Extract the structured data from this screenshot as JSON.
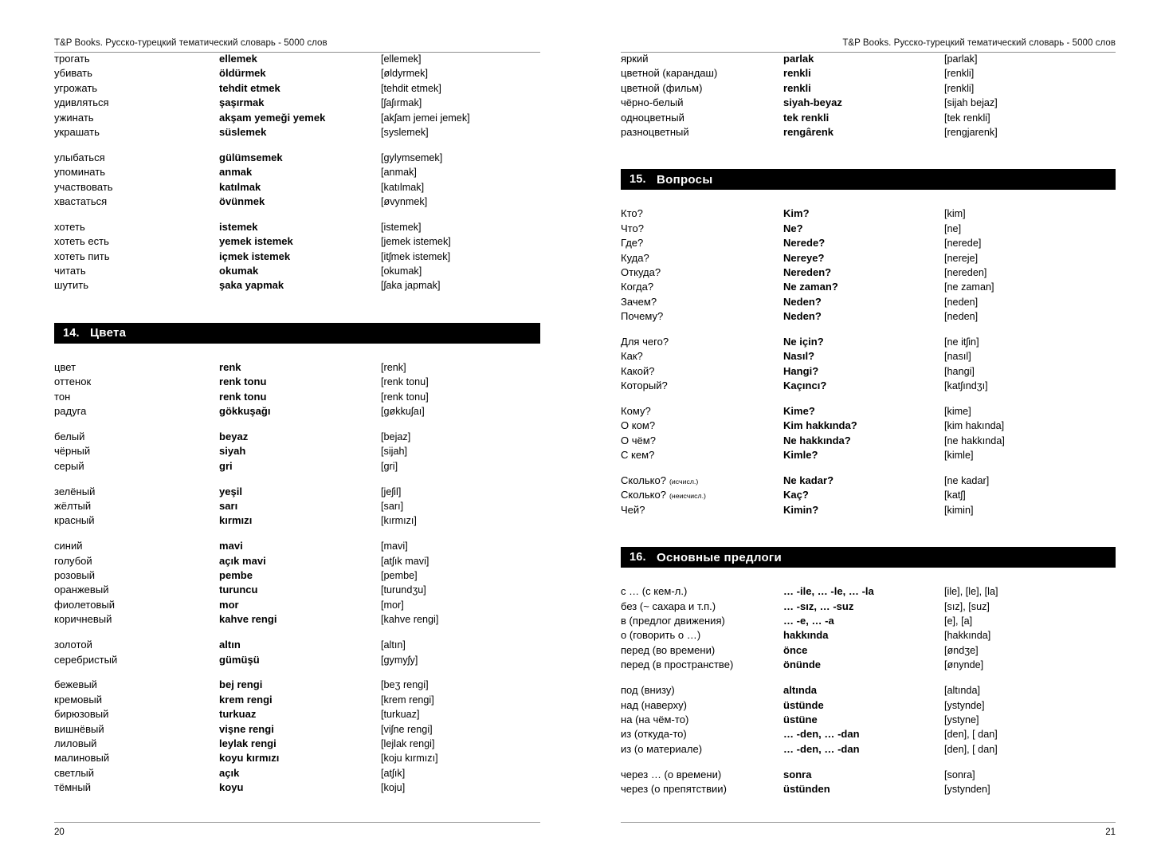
{
  "book": {
    "running_header": "T&P Books. Русско-турецкий тематический словарь - 5000 слов"
  },
  "left_page": {
    "page_number": "20",
    "blocks": [
      {
        "kind": "entries",
        "rows": [
          {
            "ru": "трогать",
            "tr": "ellemek",
            "ph": "[ellemek]"
          },
          {
            "ru": "убивать",
            "tr": "öldürmek",
            "ph": "[øldyrmek]"
          },
          {
            "ru": "угрожать",
            "tr": "tehdit etmek",
            "ph": "[tehdit etmek]"
          },
          {
            "ru": "удивляться",
            "tr": "şaşırmak",
            "ph": "[ʃaʃırmak]"
          },
          {
            "ru": "ужинать",
            "tr": "akşam yemeği yemek",
            "ph": "[akʃam jemei jemek]"
          },
          {
            "ru": "украшать",
            "tr": "süslemek",
            "ph": "[syslemek]"
          }
        ]
      },
      {
        "kind": "entries",
        "rows": [
          {
            "ru": "улыбаться",
            "tr": "gülümsemek",
            "ph": "[gylymsemek]"
          },
          {
            "ru": "упоминать",
            "tr": "anmak",
            "ph": "[anmak]"
          },
          {
            "ru": "участвовать",
            "tr": "katılmak",
            "ph": "[katılmak]"
          },
          {
            "ru": "хвастаться",
            "tr": "övünmek",
            "ph": "[øvynmek]"
          }
        ]
      },
      {
        "kind": "entries",
        "rows": [
          {
            "ru": "хотеть",
            "tr": "istemek",
            "ph": "[istemek]"
          },
          {
            "ru": "хотеть есть",
            "tr": "yemek istemek",
            "ph": "[jemek istemek]"
          },
          {
            "ru": "хотеть пить",
            "tr": "içmek istemek",
            "ph": "[itʃmek istemek]"
          },
          {
            "ru": "читать",
            "tr": "okumak",
            "ph": "[okumak]"
          },
          {
            "ru": "шутить",
            "tr": "şaka yapmak",
            "ph": "[ʃaka japmak]"
          }
        ]
      },
      {
        "kind": "section",
        "number": "14.",
        "title": "Цвета"
      },
      {
        "kind": "entries",
        "rows": [
          {
            "ru": "цвет",
            "tr": "renk",
            "ph": "[renk]"
          },
          {
            "ru": "оттенок",
            "tr": "renk tonu",
            "ph": "[renk tonu]"
          },
          {
            "ru": "тон",
            "tr": "renk tonu",
            "ph": "[renk tonu]"
          },
          {
            "ru": "радуга",
            "tr": "gökkuşağı",
            "ph": "[gøkkuʃaı]"
          }
        ]
      },
      {
        "kind": "entries",
        "rows": [
          {
            "ru": "белый",
            "tr": "beyaz",
            "ph": "[bejaz]"
          },
          {
            "ru": "чёрный",
            "tr": "siyah",
            "ph": "[sijah]"
          },
          {
            "ru": "серый",
            "tr": "gri",
            "ph": "[gri]"
          }
        ]
      },
      {
        "kind": "entries",
        "rows": [
          {
            "ru": "зелёный",
            "tr": "yeşil",
            "ph": "[jeʃil]"
          },
          {
            "ru": "жёлтый",
            "tr": "sarı",
            "ph": "[sarı]"
          },
          {
            "ru": "красный",
            "tr": "kırmızı",
            "ph": "[kırmızı]"
          }
        ]
      },
      {
        "kind": "entries",
        "rows": [
          {
            "ru": "синий",
            "tr": "mavi",
            "ph": "[mavi]"
          },
          {
            "ru": "голубой",
            "tr": "açık mavi",
            "ph": "[atʃık mavi]"
          },
          {
            "ru": "розовый",
            "tr": "pembe",
            "ph": "[pembe]"
          },
          {
            "ru": "оранжевый",
            "tr": "turuncu",
            "ph": "[turundʒu]"
          },
          {
            "ru": "фиолетовый",
            "tr": "mor",
            "ph": "[mor]"
          },
          {
            "ru": "коричневый",
            "tr": "kahve rengi",
            "ph": "[kahve rengi]"
          }
        ]
      },
      {
        "kind": "entries",
        "rows": [
          {
            "ru": "золотой",
            "tr": "altın",
            "ph": "[altın]"
          },
          {
            "ru": "серебристый",
            "tr": "gümüşü",
            "ph": "[gymyʃy]"
          }
        ]
      },
      {
        "kind": "entries",
        "rows": [
          {
            "ru": "бежевый",
            "tr": "bej rengi",
            "ph": "[beʒ rengi]"
          },
          {
            "ru": "кремовый",
            "tr": "krem rengi",
            "ph": "[krem rengi]"
          },
          {
            "ru": "бирюзовый",
            "tr": "turkuaz",
            "ph": "[turkuaz]"
          },
          {
            "ru": "вишнёвый",
            "tr": "vişne rengi",
            "ph": "[viʃne rengi]"
          },
          {
            "ru": "лиловый",
            "tr": "leylak rengi",
            "ph": "[lejlak rengi]"
          },
          {
            "ru": "малиновый",
            "tr": "koyu kırmızı",
            "ph": "[koju kırmızı]"
          },
          {
            "ru": "светлый",
            "tr": "açık",
            "ph": "[atʃık]"
          },
          {
            "ru": "тёмный",
            "tr": "koyu",
            "ph": "[koju]"
          }
        ]
      }
    ]
  },
  "right_page": {
    "page_number": "21",
    "blocks": [
      {
        "kind": "entries",
        "rows": [
          {
            "ru": "яркий",
            "tr": "parlak",
            "ph": "[parlak]"
          },
          {
            "ru": "цветной (карандаш)",
            "tr": "renkli",
            "ph": "[renkli]"
          },
          {
            "ru": "цветной (фильм)",
            "tr": "renkli",
            "ph": "[renkli]"
          },
          {
            "ru": "чёрно-белый",
            "tr": "siyah-beyaz",
            "ph": "[sijah bejaz]"
          },
          {
            "ru": "одноцветный",
            "tr": "tek renkli",
            "ph": "[tek renkli]"
          },
          {
            "ru": "разноцветный",
            "tr": "rengârenk",
            "ph": "[rengjarenk]"
          }
        ]
      },
      {
        "kind": "section",
        "number": "15.",
        "title": "Вопросы"
      },
      {
        "kind": "entries",
        "rows": [
          {
            "ru": "Кто?",
            "tr": "Kim?",
            "ph": "[kim]"
          },
          {
            "ru": "Что?",
            "tr": "Ne?",
            "ph": "[ne]"
          },
          {
            "ru": "Где?",
            "tr": "Nerede?",
            "ph": "[nerede]"
          },
          {
            "ru": "Куда?",
            "tr": "Nereye?",
            "ph": "[nereje]"
          },
          {
            "ru": "Откуда?",
            "tr": "Nereden?",
            "ph": "[nereden]"
          },
          {
            "ru": "Когда?",
            "tr": "Ne zaman?",
            "ph": "[ne zaman]"
          },
          {
            "ru": "Зачем?",
            "tr": "Neden?",
            "ph": "[neden]"
          },
          {
            "ru": "Почему?",
            "tr": "Neden?",
            "ph": "[neden]"
          }
        ]
      },
      {
        "kind": "entries",
        "rows": [
          {
            "ru": "Для чего?",
            "tr": "Ne için?",
            "ph": "[ne itʃin]"
          },
          {
            "ru": "Как?",
            "tr": "Nasıl?",
            "ph": "[nasıl]"
          },
          {
            "ru": "Какой?",
            "tr": "Hangi?",
            "ph": "[hangi]"
          },
          {
            "ru": "Который?",
            "tr": "Kaçıncı?",
            "ph": "[katʃındʒı]"
          }
        ]
      },
      {
        "kind": "entries",
        "rows": [
          {
            "ru": "Кому?",
            "tr": "Kime?",
            "ph": "[kime]"
          },
          {
            "ru": "О ком?",
            "tr": "Kim hakkında?",
            "ph": "[kim hakında]"
          },
          {
            "ru": "О чём?",
            "tr": "Ne hakkında?",
            "ph": "[ne hakkında]"
          },
          {
            "ru": "С кем?",
            "tr": "Kimle?",
            "ph": "[kimle]"
          }
        ]
      },
      {
        "kind": "entries",
        "rows": [
          {
            "ru": "Сколько?",
            "note": "(исчисл.)",
            "tr": "Ne kadar?",
            "ph": "[ne kadar]"
          },
          {
            "ru": "Сколько?",
            "note": "(неисчисл.)",
            "tr": "Kaç?",
            "ph": "[katʃ]"
          },
          {
            "ru": "Чей?",
            "tr": "Kimin?",
            "ph": "[kimin]"
          }
        ]
      },
      {
        "kind": "section",
        "number": "16.",
        "title": "Основные предлоги"
      },
      {
        "kind": "entries",
        "rows": [
          {
            "ru": "с … (с кем-л.)",
            "tr": "… -ile, … -le, … -la",
            "ph": "[ile], [le], [la]"
          },
          {
            "ru": "без (~ сахара и т.п.)",
            "tr": "… -sız, … -suz",
            "ph": "[sız], [suz]"
          },
          {
            "ru": "в (предлог движения)",
            "tr": "… -e, … -a",
            "ph": "[e], [a]"
          },
          {
            "ru": "о (говорить о …)",
            "tr": "hakkında",
            "ph": "[hakkında]"
          },
          {
            "ru": "перед (во времени)",
            "tr": "önce",
            "ph": "[øndʒe]"
          },
          {
            "ru": "перед (в пространстве)",
            "tr": "önünde",
            "ph": "[ønynde]"
          }
        ]
      },
      {
        "kind": "entries",
        "rows": [
          {
            "ru": "под (внизу)",
            "tr": "altında",
            "ph": "[altında]"
          },
          {
            "ru": "над (наверху)",
            "tr": "üstünde",
            "ph": "[ystynde]"
          },
          {
            "ru": "на (на чём-то)",
            "tr": "üstüne",
            "ph": "[ystyne]"
          },
          {
            "ru": "из (откуда-то)",
            "tr": "… -den, … -dan",
            "ph": "[den], [ dan]"
          },
          {
            "ru": "из (о материале)",
            "tr": "… -den, … -dan",
            "ph": "[den], [ dan]"
          }
        ]
      },
      {
        "kind": "entries",
        "rows": [
          {
            "ru": "через … (о времени)",
            "tr": "sonra",
            "ph": "[sonra]"
          },
          {
            "ru": "через (о препятствии)",
            "tr": "üstünden",
            "ph": "[ystynden]"
          }
        ]
      }
    ]
  }
}
